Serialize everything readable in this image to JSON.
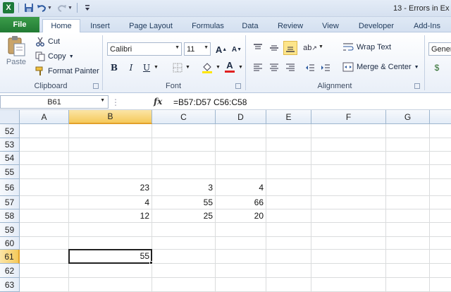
{
  "window": {
    "title": "13 - Errors in Ex"
  },
  "quick_access": {
    "logo_letter": "X",
    "icons": [
      "excel-logo-icon",
      "save-icon",
      "undo-icon",
      "redo-icon",
      "customize-icon"
    ]
  },
  "tabs": [
    {
      "label": "File"
    },
    {
      "label": "Home"
    },
    {
      "label": "Insert"
    },
    {
      "label": "Page Layout"
    },
    {
      "label": "Formulas"
    },
    {
      "label": "Data"
    },
    {
      "label": "Review"
    },
    {
      "label": "View"
    },
    {
      "label": "Developer"
    },
    {
      "label": "Add-Ins"
    }
  ],
  "active_tab": "Home",
  "ribbon": {
    "clipboard": {
      "label": "Clipboard",
      "paste": "Paste",
      "cut": "Cut",
      "copy": "Copy",
      "format_painter": "Format Painter"
    },
    "font": {
      "label": "Font",
      "font_name": "Calibri",
      "font_size": "11",
      "bold": "B",
      "italic": "I",
      "underline": "U",
      "grow": "A",
      "shrink": "A",
      "font_color_letter": "A"
    },
    "alignment": {
      "label": "Alignment",
      "wrap_text": "Wrap Text",
      "merge_center": "Merge & Center"
    },
    "number": {
      "format": "Gener"
    }
  },
  "formula_bar": {
    "name_box": "B61",
    "fx": "fx",
    "formula": "=B57:D57 C56:C58"
  },
  "sheet": {
    "columns": [
      "A",
      "B",
      "C",
      "D",
      "E",
      "F",
      "G"
    ],
    "selected_column": "B",
    "rows": [
      "52",
      "53",
      "54",
      "55",
      "56",
      "57",
      "58",
      "59",
      "60",
      "61",
      "62",
      "63"
    ],
    "selected_row": "61",
    "cells": {
      "B56": "23",
      "C56": "3",
      "D56": "4",
      "B57": "4",
      "C57": "55",
      "D57": "66",
      "B58": "12",
      "C58": "25",
      "D58": "20",
      "B61": "55"
    }
  },
  "colors": {
    "file_tab": "#217a33",
    "selected_header": "#f5c95a",
    "gridline": "#dadcdd"
  }
}
